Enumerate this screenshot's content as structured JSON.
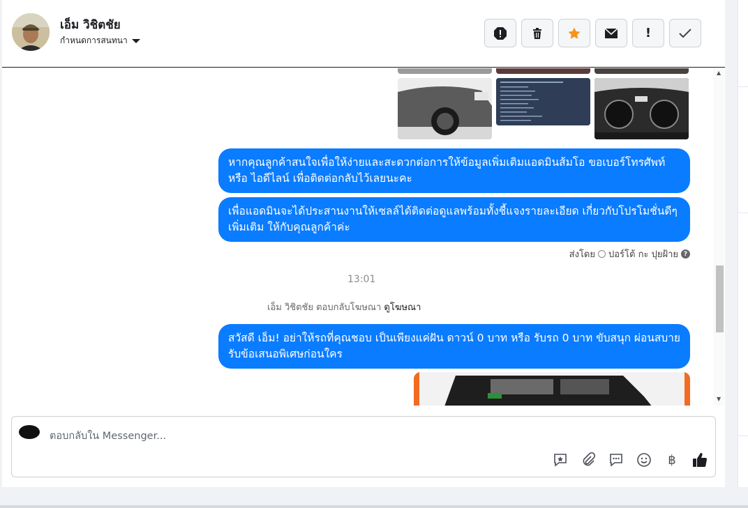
{
  "contact": {
    "name": "เอ็ม วิชิตชัย",
    "assign_label": "กำหนดการสนทนา"
  },
  "actions": [
    {
      "name": "spam-icon",
      "glyph": "!"
    },
    {
      "name": "trash-icon",
      "glyph": "🗑"
    },
    {
      "name": "star-icon",
      "glyph": "★"
    },
    {
      "name": "mail-icon",
      "glyph": "✉"
    },
    {
      "name": "follow-up-icon",
      "glyph": "!"
    },
    {
      "name": "done-icon",
      "glyph": "✓"
    }
  ],
  "messages": {
    "m1": "หากคุณลูกค้าสนใจเพื่อให้ง่ายและสะดวกต่อการให้ข้อมูลเพิ่มเติมแอดมินส้มโอ ขอเบอร์โทรศัพท์ หรือ ไอดีไลน์ เพื่อติดต่อกลับไว้เลยนะคะ",
    "m2": "เพื่อแอดมินจะได้ประสานงานให้เซลล์ได้ติดต่อดูแลพร้อมทั้งชี้แจงรายละเอียด เกี่ยวกับโปรโมชั่นดีๆเพิ่มเติม ให้กับคุณลูกค้าค่ะ",
    "sent_by_label": "ส่งโดย",
    "sent_by_name": "ปอร์โต้ กะ ปุยฝ้าย",
    "time": "13:01",
    "reply_info": "เอ็ม วิชิตชัย ตอบกลับโฆษณา",
    "reply_link": "ดูโฆษณา",
    "m3": "สวัสดี เอ็ม! อย่าให้รถที่คุณชอบ เป็นเพียงแค่ฝัน ดาวน์ 0 บาท หรือ รับรถ 0 บาท ขับสนุก ผ่อนสบาย รับข้อเสนอพิเศษก่อนใคร"
  },
  "composer": {
    "placeholder": "ตอบกลับใน Messenger..."
  },
  "colors": {
    "bubble": "#0a7cff",
    "star": "#f7931e"
  }
}
